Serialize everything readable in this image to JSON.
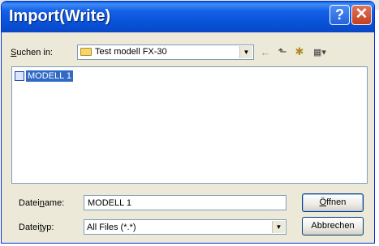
{
  "window": {
    "title": "Import(Write)",
    "help_glyph": "?",
    "close_glyph": "✕"
  },
  "lookin": {
    "label_prefix": "S",
    "label_rest": "uchen in:",
    "folder": "Test modell FX-30"
  },
  "toolbar": {
    "back_icon": "←",
    "up_icon": "⬑",
    "new_folder_icon": "✱",
    "view_icon": "▦▾"
  },
  "files": [
    {
      "name": "MODELL 1",
      "selected": true
    }
  ],
  "filename": {
    "label_a": "Datei",
    "label_u": "n",
    "label_b": "ame:",
    "value": "MODELL 1"
  },
  "filetype": {
    "label_a": "Datei",
    "label_u": "t",
    "label_b": "yp:",
    "value": "All Files (*.*)"
  },
  "buttons": {
    "open_u": "Ö",
    "open_rest": "ffnen",
    "cancel": "Abbrechen"
  },
  "colors": {
    "titlebar": "#0a5fe6",
    "selection": "#316ac5",
    "dialog_bg": "#ece9d8"
  }
}
